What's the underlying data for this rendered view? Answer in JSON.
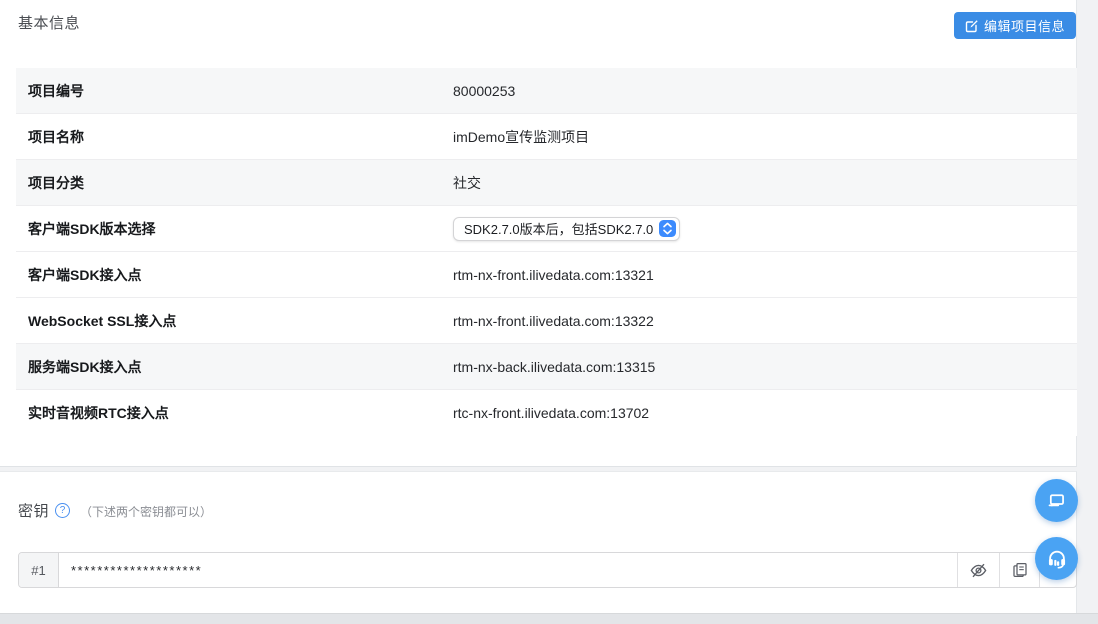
{
  "basic_section": {
    "title": "基本信息",
    "edit_button_label": "编辑项目信息"
  },
  "info_table": {
    "rows": [
      {
        "label": "项目编号",
        "value": "80000253"
      },
      {
        "label": "项目名称",
        "value": "imDemo宣传监测项目"
      },
      {
        "label": "项目分类",
        "value": "社交"
      },
      {
        "label": "客户端SDK版本选择",
        "value": "SDK2.7.0版本后，包括SDK2.7.0",
        "control": "select"
      },
      {
        "label": "客户端SDK接入点",
        "value": "rtm-nx-front.ilivedata.com:13321"
      },
      {
        "label": "WebSocket SSL接入点",
        "value": "rtm-nx-front.ilivedata.com:13322"
      },
      {
        "label": "服务端SDK接入点",
        "value": "rtm-nx-back.ilivedata.com:13315"
      },
      {
        "label": "实时音视频RTC接入点",
        "value": "rtc-nx-front.ilivedata.com:13702"
      }
    ]
  },
  "secret_section": {
    "title": "密钥",
    "help_icon": "?",
    "hint": "（下述两个密钥都可以）",
    "keys": [
      {
        "index_label": "#1",
        "masked_value": "********************"
      }
    ]
  },
  "icons": {
    "edit": "edit-square-icon",
    "eye_hidden": "eye-off-icon",
    "copy": "copy-icon",
    "chat": "chat-bubble-icon",
    "headset": "headset-icon"
  },
  "colors": {
    "primary_button": "#3a8ce5",
    "floating_button": "#4aa3f3",
    "select_stepper": "#3d8bfd",
    "help_icon_blue": "#4a90f0",
    "striped_row": "#f6f7f8"
  }
}
